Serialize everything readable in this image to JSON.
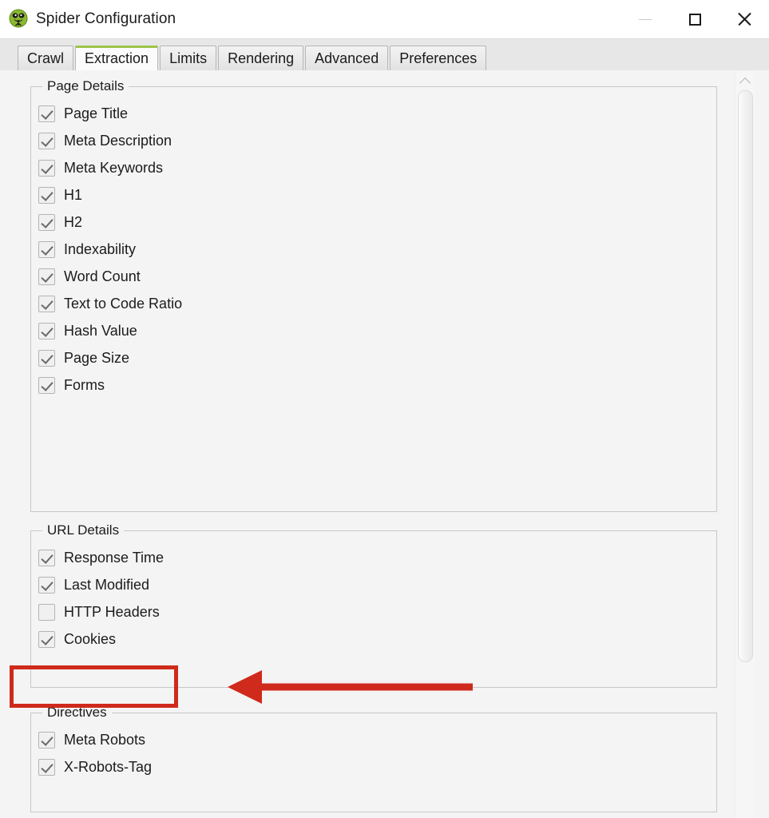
{
  "window": {
    "title": "Spider Configuration",
    "icon": "spider-logo-icon",
    "controls": {
      "minimize": "—",
      "maximize": "□",
      "close": "✕"
    }
  },
  "tabs": [
    {
      "label": "Crawl",
      "active": false
    },
    {
      "label": "Extraction",
      "active": true
    },
    {
      "label": "Limits",
      "active": false
    },
    {
      "label": "Rendering",
      "active": false
    },
    {
      "label": "Advanced",
      "active": false
    },
    {
      "label": "Preferences",
      "active": false
    }
  ],
  "groups": [
    {
      "title": "Page Details",
      "items": [
        {
          "label": "Page Title",
          "checked": true
        },
        {
          "label": "Meta Description",
          "checked": true
        },
        {
          "label": "Meta Keywords",
          "checked": true
        },
        {
          "label": "H1",
          "checked": true
        },
        {
          "label": "H2",
          "checked": true
        },
        {
          "label": "Indexability",
          "checked": true
        },
        {
          "label": "Word Count",
          "checked": true
        },
        {
          "label": "Text to Code Ratio",
          "checked": true
        },
        {
          "label": "Hash Value",
          "checked": true
        },
        {
          "label": "Page Size",
          "checked": true
        },
        {
          "label": "Forms",
          "checked": true
        }
      ]
    },
    {
      "title": "URL Details",
      "items": [
        {
          "label": "Response Time",
          "checked": true
        },
        {
          "label": "Last Modified",
          "checked": true
        },
        {
          "label": "HTTP Headers",
          "checked": false
        },
        {
          "label": "Cookies",
          "checked": true,
          "highlighted": true
        }
      ]
    },
    {
      "title": "Directives",
      "items": [
        {
          "label": "Meta Robots",
          "checked": true
        },
        {
          "label": "X-Robots-Tag",
          "checked": true
        }
      ]
    }
  ],
  "annotations": {
    "highlight_color": "#cf2a1b",
    "highlighted_option": "Cookies",
    "arrow_direction": "left"
  },
  "colors": {
    "accent_green": "#9cc44a",
    "panel_background": "#f4f4f4",
    "tab_strip": "#e7e7e7",
    "annotation_red": "#cf2a1b"
  },
  "scrollbar": {
    "orientation": "vertical",
    "up_arrow": "∧"
  }
}
